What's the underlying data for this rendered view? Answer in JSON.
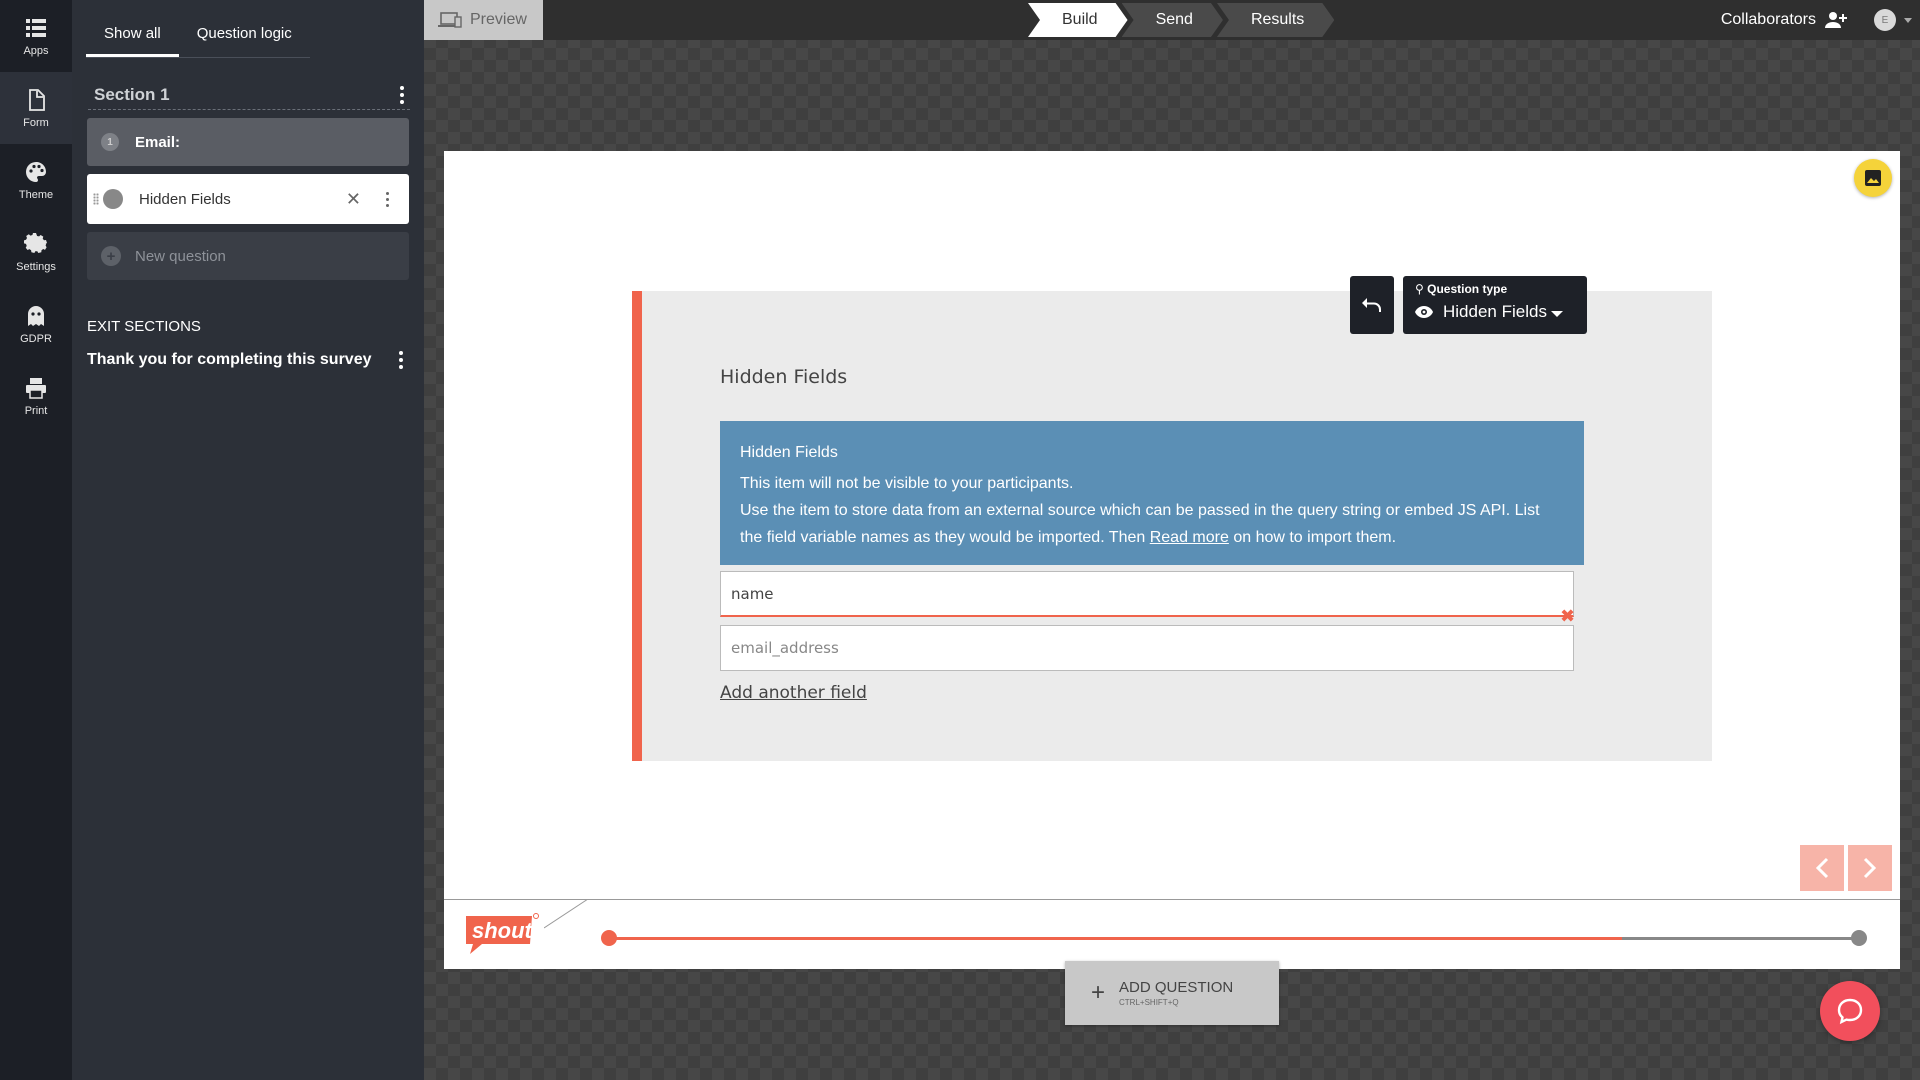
{
  "rail": {
    "apps": "Apps",
    "form": "Form",
    "theme": "Theme",
    "settings": "Settings",
    "gdpr": "GDPR",
    "print": "Print"
  },
  "sidebar": {
    "tabs": [
      "Show all",
      "Question logic"
    ],
    "section_title": "Section 1",
    "questions": [
      {
        "number": "1",
        "label": "Email:"
      },
      {
        "label": "Hidden Fields"
      }
    ],
    "new_question": "New question",
    "exit_sections_label": "EXIT SECTIONS",
    "exit_title": "Thank you for completing this survey"
  },
  "topbar": {
    "preview": "Preview",
    "steps": [
      "Build",
      "Send",
      "Results"
    ],
    "collaborators": "Collaborators",
    "avatar_initial": "E"
  },
  "question": {
    "type_label": "Question type",
    "type_value": "Hidden Fields",
    "title": "Hidden Fields",
    "info_title": "Hidden Fields",
    "info_line1": "This item will not be visible to your participants.",
    "info_line2_pre": "Use the item to store data from an external source which can be passed in the query string or embed JS API. List the field variable names as they would be imported. Then ",
    "info_link": "Read more",
    "info_line2_post": " on how to import them.",
    "field1_value": "name",
    "field2_placeholder": "email_address",
    "add_field": "Add another field"
  },
  "footer": {
    "logo": "shout",
    "progress": 0.81
  },
  "add_question": {
    "label": "ADD QUESTION",
    "shortcut": "CTRL+SHIFT+Q"
  },
  "colors": {
    "accent": "#f0644c",
    "info_bg": "#5b8fb5",
    "chat": "#f24f5c"
  }
}
